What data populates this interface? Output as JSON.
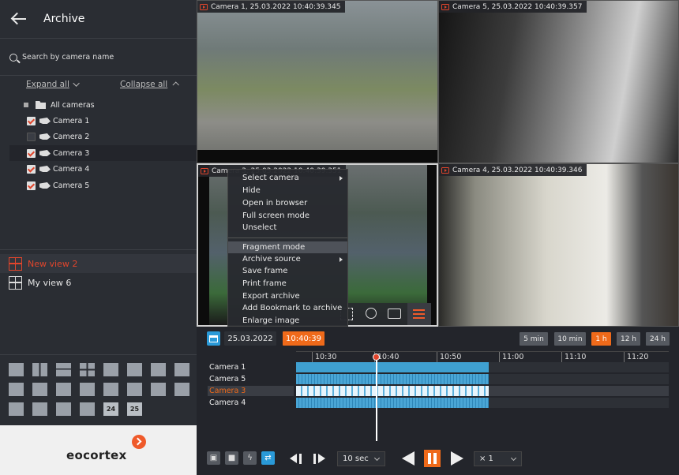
{
  "header": {
    "title": "Archive"
  },
  "search": {
    "placeholder": "Search by camera name"
  },
  "tree": {
    "expand_all": "Expand all",
    "collapse_all": "Collapse all",
    "root": "All cameras",
    "cameras": [
      {
        "label": "Camera 1",
        "checked": true
      },
      {
        "label": "Camera 2",
        "checked": false
      },
      {
        "label": "Camera 3",
        "checked": true
      },
      {
        "label": "Camera 4",
        "checked": true
      },
      {
        "label": "Camera 5",
        "checked": true
      }
    ]
  },
  "views": [
    {
      "label": "New view 2",
      "selected": true,
      "color": "#e0452c"
    },
    {
      "label": "My view 6",
      "selected": false
    }
  ],
  "layouts": {
    "label_24": "24",
    "label_25": "25"
  },
  "logo": {
    "text": "eocortex"
  },
  "cameras": [
    {
      "title": "Camera 1, 25.03.2022 10:40:39.345"
    },
    {
      "title": "Camera 5, 25.03.2022 10:40:39.357"
    },
    {
      "title": "Camera 3, 25.03.2022 10:40:39.351"
    },
    {
      "title": "Camera 4, 25.03.2022 10:40:39.346"
    }
  ],
  "context_menu": {
    "items": [
      "Select camera",
      "Hide",
      "Open in browser",
      "Full screen mode",
      "Unselect",
      "Fragment mode",
      "Archive source",
      "Save frame",
      "Print frame",
      "Export archive",
      "Add Bookmark to archive",
      "Enlarge image"
    ],
    "highlighted": "Fragment mode"
  },
  "timeline": {
    "date": "25.03.2022",
    "time": "10:40:39",
    "scales": [
      "5 min",
      "10 min",
      "1 h",
      "12 h",
      "24 h"
    ],
    "active_scale": "1 h",
    "ticks": [
      "10:30",
      "10:40",
      "10:50",
      "11:00",
      "11:10",
      "11:20"
    ],
    "rows": [
      "Camera 1",
      "Camera 5",
      "Camera 3",
      "Camera 4"
    ],
    "selected_row": "Camera 3",
    "step": "10 sec",
    "speed": "× 1"
  },
  "colors": {
    "accent": "#ef6a1a",
    "selection_red": "#e0452c",
    "archive_blue": "#3fa0d0"
  }
}
